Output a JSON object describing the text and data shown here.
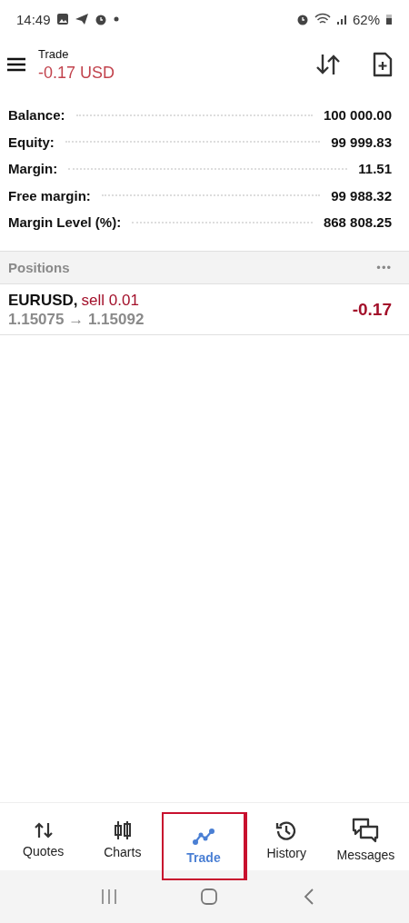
{
  "status_bar": {
    "time": "14:49",
    "battery": "62%"
  },
  "header": {
    "title": "Trade",
    "profit": "-0.17 USD"
  },
  "summary": [
    {
      "label": "Balance:",
      "value": "100 000.00"
    },
    {
      "label": "Equity:",
      "value": "99 999.83"
    },
    {
      "label": "Margin:",
      "value": "11.51"
    },
    {
      "label": "Free margin:",
      "value": "99 988.32"
    },
    {
      "label": "Margin Level (%):",
      "value": "868 808.25"
    }
  ],
  "positions_header": {
    "title": "Positions",
    "menu": "•••"
  },
  "positions": [
    {
      "symbol": "EURUSD,",
      "order": "sell 0.01",
      "prices": "1.15075 → 1.15092",
      "profit": "-0.17"
    }
  ],
  "nav": [
    {
      "label": "Quotes",
      "selected": false
    },
    {
      "label": "Charts",
      "selected": false
    },
    {
      "label": "Trade",
      "selected": true
    },
    {
      "label": "History",
      "selected": false
    },
    {
      "label": "Messages",
      "selected": false
    }
  ]
}
